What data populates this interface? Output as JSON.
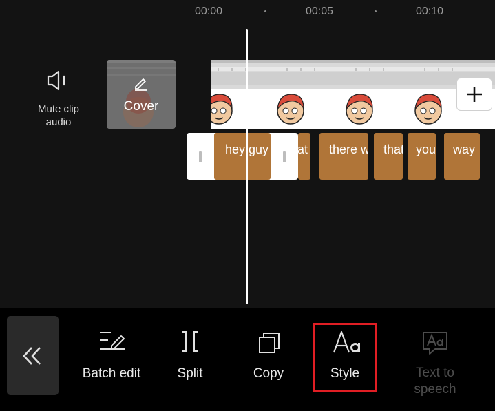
{
  "ruler": {
    "times": [
      "00:00",
      "00:05",
      "00:10"
    ]
  },
  "track_controls": {
    "mute_label": "Mute clip audio",
    "cover_label": "Cover"
  },
  "captions": [
    {
      "text": "hey guy"
    },
    {
      "text": "that"
    },
    {
      "text": "there w"
    },
    {
      "text": "that"
    },
    {
      "text": "you"
    },
    {
      "text": "way"
    }
  ],
  "toolbar": {
    "back_icon": "double-chevron-left-icon",
    "items": [
      {
        "label": "Batch edit",
        "icon": "batch-edit-icon",
        "enabled": true
      },
      {
        "label": "Split",
        "icon": "split-icon",
        "enabled": true
      },
      {
        "label": "Copy",
        "icon": "copy-icon",
        "enabled": true
      },
      {
        "label": "Style",
        "icon": "text-style-icon",
        "enabled": true,
        "highlighted": true
      },
      {
        "label": "Text to speech",
        "icon": "text-to-speech-icon",
        "enabled": false
      }
    ]
  },
  "colors": {
    "background": "#131313",
    "caption_clip": "#b07538",
    "highlight": "#e01e24",
    "toolbar": "#000000"
  }
}
